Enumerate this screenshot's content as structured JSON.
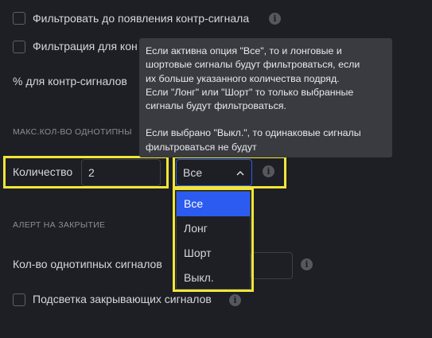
{
  "filters": {
    "filter_until_counter": {
      "label": "Фильтровать до появления контр-сигнала",
      "checked": false
    },
    "filter_for": {
      "label": "Фильтрация для кон",
      "checked": false
    },
    "counter_percent_label": "% для контр-сигналов"
  },
  "tooltip": {
    "lines": [
      "Если активна опция \"Все\", то и лонговые и",
      "шортовые сигналы будут фильтроваться, если",
      "их больше указанного количества подряд.",
      "Если \"Лонг\" или \"Шорт\" то только выбранные",
      "сигналы будут фильтроваться.",
      "",
      "Если выбрано \"Выкл.\", то одинаковые сигналы",
      "фильтроваться не будут"
    ]
  },
  "max_same": {
    "section_label": "МАКС.КОЛ-ВО ОДНОТИПНЫ",
    "quantity_label": "Количество",
    "quantity_value": "2",
    "mode_selected": "Все",
    "options": [
      "Все",
      "Лонг",
      "Шорт",
      "Выкл."
    ]
  },
  "close_alert": {
    "section_label": "АЛЕРТ НА ЗАКРЫТИЕ",
    "same_signals_label": "Кол-во однотипных сигналов",
    "highlight_label": "Подсветка закрывающих сигналов",
    "highlight_checked": false
  },
  "colors": {
    "background": "#1e1f24",
    "highlight": "#f0e637",
    "selected_option": "#2c5bf0",
    "tooltip_bg": "#3a3b40"
  },
  "icons": [
    "info-icon",
    "chevron-up-icon"
  ]
}
